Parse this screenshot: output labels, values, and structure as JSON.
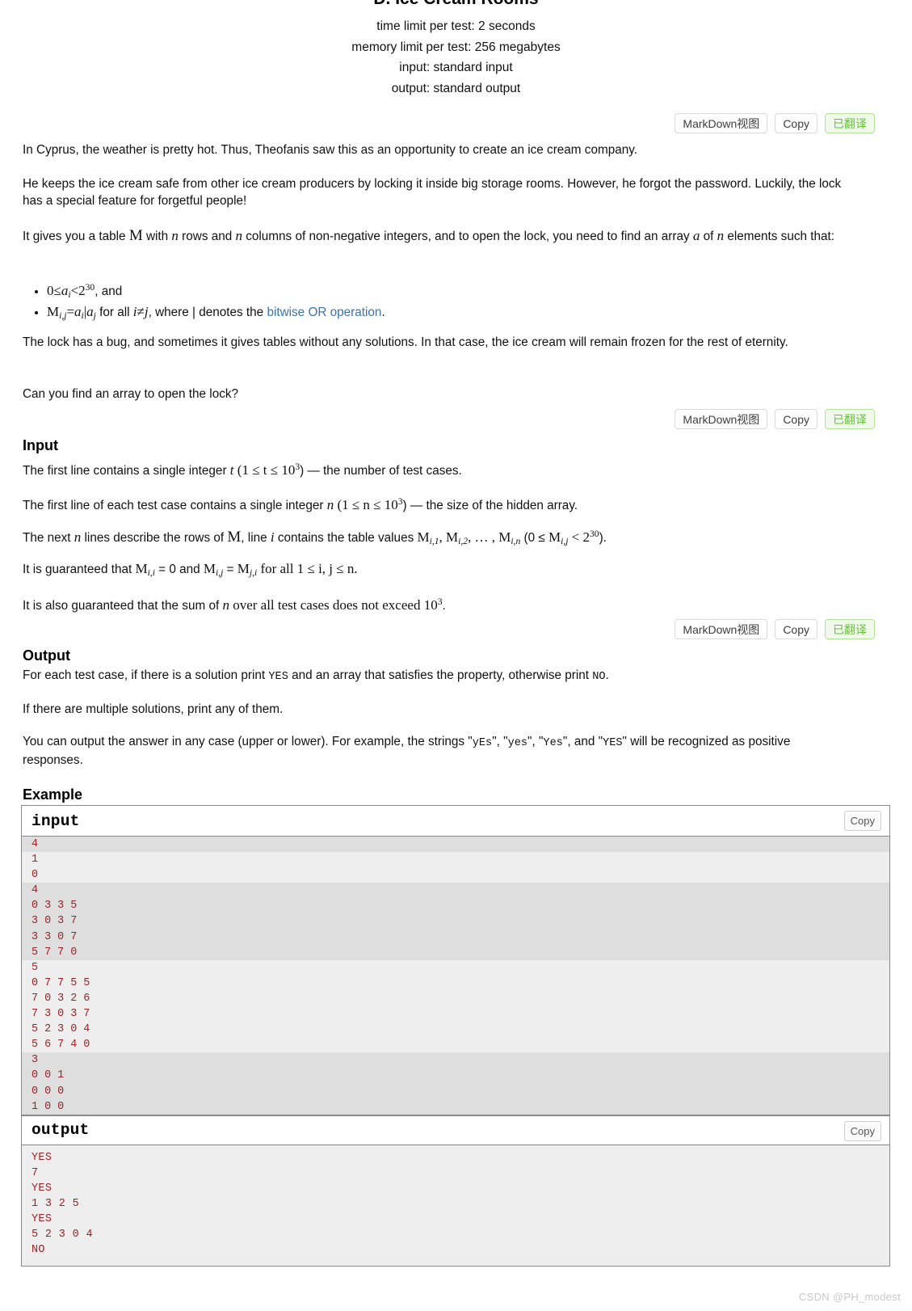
{
  "problem": {
    "title": "D. Ice Cream Rooms",
    "limits": [
      "time limit per test: 2 seconds",
      "memory limit per test: 256 megabytes",
      "input: standard input",
      "output: standard output"
    ]
  },
  "toolbar": {
    "markdown_label": "MarkDown视图",
    "copy_label": "Copy",
    "translated_label": "已翻译"
  },
  "statement": {
    "p1": "In Cyprus, the weather is pretty hot. Thus, Theofanis saw this as an opportunity to create an ice cream company.",
    "p2": "He keeps the ice cream safe from other ice cream producers by locking it inside big storage rooms. However, he forgot the password. Luckily, the lock has a special feature for forgetful people!",
    "p3_a": "It gives you a table ",
    "p3_M": "M",
    "p3_b": " with ",
    "p3_n1": "n",
    "p3_c": " rows and ",
    "p3_n2": "n",
    "p3_d": " columns of non-negative integers, and to open the lock, you need to find an array ",
    "p3_a_var": "a",
    "p3_e": " of ",
    "p3_n3": "n",
    "p3_f": " elements such that:",
    "bullet1_math_1": "0",
    "bullet1_math_le": "≤",
    "bullet1_math_a": "a",
    "bullet1_math_isub": "i",
    "bullet1_math_lt": "<",
    "bullet1_math_2": "2",
    "bullet1_math_30": "30",
    "bullet1_tail": ", and",
    "bullet2_M": "M",
    "bullet2_Msub": "i,j",
    "bullet2_eq": "=",
    "bullet2_ai": "a",
    "bullet2_aisub": "i",
    "bullet2_pipe": "|",
    "bullet2_aj": "a",
    "bullet2_ajsub": "j",
    "bullet2_mid": " for all ",
    "bullet2_i": "i",
    "bullet2_neq": "≠",
    "bullet2_j": "j",
    "bullet2_where": ", where | denotes the ",
    "bullet2_link": "bitwise OR operation",
    "bullet2_end": ".",
    "p4": "The lock has a bug, and sometimes it gives tables without any solutions. In that case, the ice cream will remain frozen for the rest of eternity.",
    "p5": "Can you find an array to open the lock?"
  },
  "input_section": {
    "heading": "Input",
    "l1_a": "The first line contains a single integer ",
    "l1_t": "t",
    "l1_b": " (1 ≤ t ≤ 10",
    "l1_sup": "3",
    "l1_c": ") — the number of test cases.",
    "l2_a": "The first line of each test case contains a single integer ",
    "l2_n": "n",
    "l2_b": " (1 ≤ n ≤ 10",
    "l2_sup": "3",
    "l2_c": ") — the size of the hidden array.",
    "l3_a": "The next ",
    "l3_n": "n",
    "l3_b": " lines describe the rows of ",
    "l3_M": "M",
    "l3_c": ", line ",
    "l3_i": "i",
    "l3_d": " contains the table values ",
    "l3_vals": "M",
    "l3_e": " (0 ≤ ",
    "l3_Mij": "M",
    "l3_f": " < 2",
    "l3_sup": "30",
    "l3_g": ").",
    "l4_a": "It is guaranteed that ",
    "l4_b": " = 0 and ",
    "l4_c": " = ",
    "l4_d": " for all 1 ≤ i, j ≤ n.",
    "l5_a": "It is also guaranteed that the sum of ",
    "l5_n": "n",
    "l5_b": " over all test cases does not exceed 10",
    "l5_sup": "3",
    "l5_c": "."
  },
  "output_section": {
    "heading": "Output",
    "l1_a": "For each test case, if there is a solution print ",
    "l1_yes": "YES",
    "l1_b": " and an array that satisfies the property, otherwise print ",
    "l1_no": "NO",
    "l1_c": ".",
    "l2": "If there are multiple solutions, print any of them.",
    "l3_a": "You can output the answer in any case (upper or lower). For example, the strings \"",
    "l3_yEs": "yEs",
    "l3_b": "\", \"",
    "l3_yes": "yes",
    "l3_c": "\", \"",
    "l3_Yes": "Yes",
    "l3_d": "\", and \"",
    "l3_YES": "YES",
    "l3_e": "\" will be recognized as positive responses."
  },
  "example": {
    "heading": "Example",
    "input_label": "input",
    "output_label": "output",
    "copy_label": "Copy",
    "input_lines": [
      {
        "text": "4",
        "group": "a"
      },
      {
        "text": "1",
        "group": "b"
      },
      {
        "text": "0",
        "group": "b"
      },
      {
        "text": "4",
        "group": "a"
      },
      {
        "text": "0 3 3 5",
        "group": "a"
      },
      {
        "text": "3 0 3 7",
        "group": "a"
      },
      {
        "text": "3 3 0 7",
        "group": "a"
      },
      {
        "text": "5 7 7 0",
        "group": "a"
      },
      {
        "text": "5",
        "group": "b"
      },
      {
        "text": "0 7 7 5 5",
        "group": "b"
      },
      {
        "text": "7 0 3 2 6",
        "group": "b"
      },
      {
        "text": "7 3 0 3 7",
        "group": "b"
      },
      {
        "text": "5 2 3 0 4",
        "group": "b"
      },
      {
        "text": "5 6 7 4 0",
        "group": "b"
      },
      {
        "text": "3",
        "group": "a"
      },
      {
        "text": "0 0 1",
        "group": "a"
      },
      {
        "text": "0 0 0",
        "group": "a"
      },
      {
        "text": "1 0 0",
        "group": "a"
      }
    ],
    "output_lines": [
      "YES",
      "7",
      "YES",
      "1 3 2 5",
      "YES",
      "5 2 3 0 4",
      "NO"
    ]
  },
  "watermark": "CSDN @PH_modest"
}
